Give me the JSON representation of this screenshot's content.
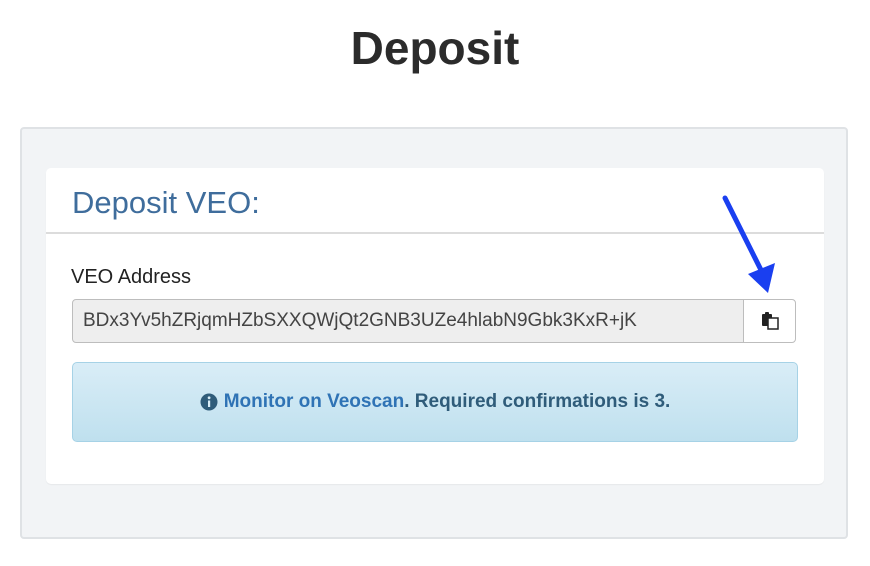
{
  "page": {
    "title": "Deposit"
  },
  "panel": {
    "title": "Deposit VEO:"
  },
  "address": {
    "label": "VEO Address",
    "value": "BDx3Yv5hZRjqmHZbSXXQWjQt2GNB3UZe4hlabN9Gbk3KxR+jK"
  },
  "copy_button": {
    "icon": "clipboard-copy-icon"
  },
  "alert": {
    "icon": "info-circle-icon",
    "link_text": "Monitor on Veoscan",
    "message": ". Required confirmations is 3."
  },
  "annotation": {
    "icon": "blue-arrow",
    "color": "#1a3ff0"
  }
}
